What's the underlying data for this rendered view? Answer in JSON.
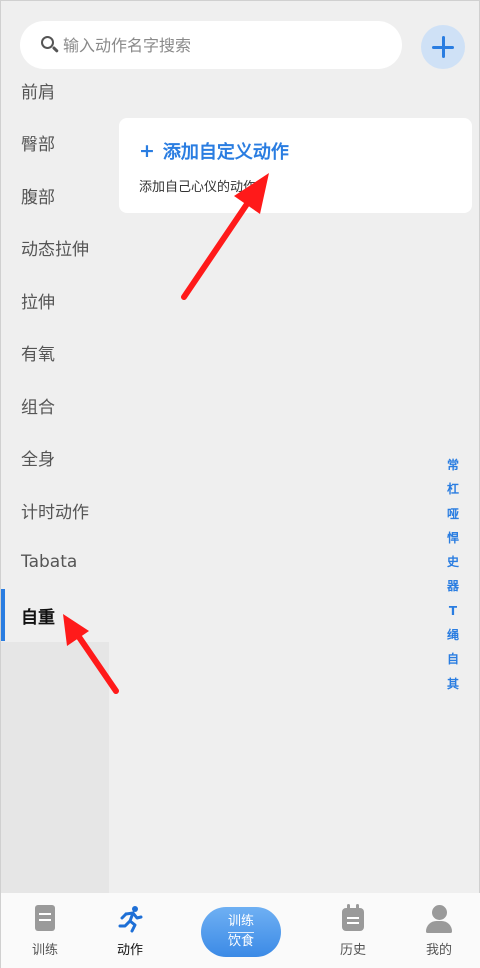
{
  "search": {
    "placeholder": "输入动作名字搜索"
  },
  "sidebar": {
    "items": [
      {
        "label": "前肩"
      },
      {
        "label": "臀部"
      },
      {
        "label": "腹部"
      },
      {
        "label": "动态拉伸"
      },
      {
        "label": "拉伸"
      },
      {
        "label": "有氧"
      },
      {
        "label": "组合"
      },
      {
        "label": "全身"
      },
      {
        "label": "计时动作"
      },
      {
        "label": "Tabata"
      },
      {
        "label": "自重",
        "active": true
      }
    ]
  },
  "custom_card": {
    "plus": "+",
    "title": "添加自定义动作",
    "description": "添加自己心仪的动作"
  },
  "index_bar": [
    "常",
    "杠",
    "哑",
    "悍",
    "史",
    "器",
    "T",
    "绳",
    "自",
    "其"
  ],
  "tabbar": {
    "train": "训练",
    "actions": "动作",
    "center_top": "训练",
    "center_bottom": "饮食",
    "history": "历史",
    "mine": "我的"
  },
  "colors": {
    "accent": "#2a7de1",
    "annotation_arrow": "#ff1a1a"
  }
}
